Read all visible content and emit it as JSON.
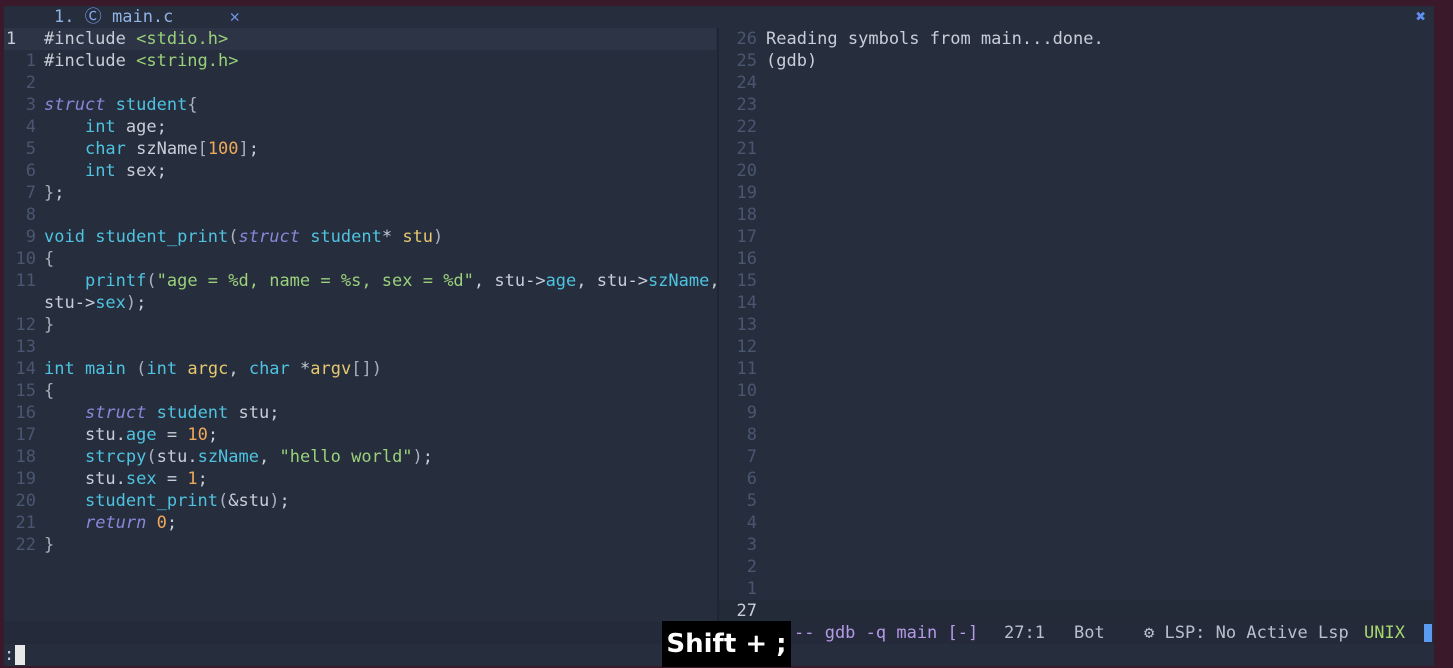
{
  "tab": {
    "index": "1.",
    "icon": "c-file-icon",
    "name": "main.c",
    "close": "✕",
    "close_all": "✖"
  },
  "editor": {
    "lines": [
      {
        "n": "1",
        "cur": true,
        "tokens": [
          [
            "pp",
            "#include "
          ],
          [
            "str",
            "<stdio.h>"
          ]
        ]
      },
      {
        "n": "1",
        "tokens": [
          [
            "pp",
            "#include "
          ],
          [
            "str",
            "<string.h>"
          ]
        ]
      },
      {
        "n": "2",
        "tokens": []
      },
      {
        "n": "3",
        "tokens": [
          [
            "sk",
            "struct"
          ],
          [
            "pp",
            " "
          ],
          [
            "ty",
            "student"
          ],
          [
            "br",
            "{"
          ]
        ]
      },
      {
        "n": "4",
        "tokens": [
          [
            "pp",
            "    "
          ],
          [
            "kw",
            "int"
          ],
          [
            "pp",
            " age;"
          ]
        ]
      },
      {
        "n": "5",
        "tokens": [
          [
            "pp",
            "    "
          ],
          [
            "kw",
            "char"
          ],
          [
            "pp",
            " szName"
          ],
          [
            "br",
            "["
          ],
          [
            "num",
            "100"
          ],
          [
            "br",
            "]"
          ],
          [
            "pp",
            ";"
          ]
        ]
      },
      {
        "n": "6",
        "tokens": [
          [
            "pp",
            "    "
          ],
          [
            "kw",
            "int"
          ],
          [
            "pp",
            " sex;"
          ]
        ]
      },
      {
        "n": "7",
        "tokens": [
          [
            "br",
            "}"
          ],
          [
            "pp",
            ";"
          ]
        ]
      },
      {
        "n": "8",
        "tokens": []
      },
      {
        "n": "9",
        "tokens": [
          [
            "kw",
            "void"
          ],
          [
            "pp",
            " "
          ],
          [
            "fn",
            "student_print"
          ],
          [
            "br",
            "("
          ],
          [
            "sk",
            "struct"
          ],
          [
            "pp",
            " "
          ],
          [
            "ty",
            "student"
          ],
          [
            "pp",
            "* "
          ],
          [
            "pa",
            "stu"
          ],
          [
            "br",
            ")"
          ]
        ]
      },
      {
        "n": "10",
        "tokens": [
          [
            "br",
            "{"
          ]
        ]
      },
      {
        "n": "11",
        "tokens": [
          [
            "pp",
            "    "
          ],
          [
            "fn",
            "printf"
          ],
          [
            "br",
            "("
          ],
          [
            "str",
            "\"age = %d, name = %s, sex = %d\""
          ],
          [
            "pp",
            ", stu->"
          ],
          [
            "fn",
            "age"
          ],
          [
            "pp",
            ", stu->"
          ],
          [
            "fn",
            "szName"
          ],
          [
            "pp",
            ","
          ]
        ]
      },
      {
        "n": "",
        "tokens": [
          [
            "pp",
            "stu->"
          ],
          [
            "fn",
            "sex"
          ],
          [
            "br",
            ")"
          ],
          [
            "pp",
            ";"
          ]
        ]
      },
      {
        "n": "12",
        "tokens": [
          [
            "br",
            "}"
          ]
        ]
      },
      {
        "n": "13",
        "tokens": []
      },
      {
        "n": "14",
        "tokens": [
          [
            "kw",
            "int"
          ],
          [
            "pp",
            " "
          ],
          [
            "fn",
            "main"
          ],
          [
            "pp",
            " "
          ],
          [
            "br",
            "("
          ],
          [
            "kw",
            "int"
          ],
          [
            "pp",
            " "
          ],
          [
            "pa",
            "argc"
          ],
          [
            "pp",
            ", "
          ],
          [
            "kw",
            "char"
          ],
          [
            "pp",
            " *"
          ],
          [
            "pa",
            "argv"
          ],
          [
            "br",
            "[])"
          ]
        ]
      },
      {
        "n": "15",
        "tokens": [
          [
            "br",
            "{"
          ]
        ]
      },
      {
        "n": "16",
        "tokens": [
          [
            "pp",
            "    "
          ],
          [
            "sk",
            "struct"
          ],
          [
            "pp",
            " "
          ],
          [
            "ty",
            "student"
          ],
          [
            "pp",
            " stu;"
          ]
        ]
      },
      {
        "n": "17",
        "tokens": [
          [
            "pp",
            "    stu."
          ],
          [
            "fn",
            "age"
          ],
          [
            "pp",
            " = "
          ],
          [
            "num",
            "10"
          ],
          [
            "pp",
            ";"
          ]
        ]
      },
      {
        "n": "18",
        "tokens": [
          [
            "pp",
            "    "
          ],
          [
            "fn",
            "strcpy"
          ],
          [
            "br",
            "("
          ],
          [
            "pp",
            "stu."
          ],
          [
            "fn",
            "szName"
          ],
          [
            "pp",
            ", "
          ],
          [
            "str",
            "\"hello world\""
          ],
          [
            "br",
            ")"
          ],
          [
            "pp",
            ";"
          ]
        ]
      },
      {
        "n": "19",
        "tokens": [
          [
            "pp",
            "    stu."
          ],
          [
            "fn",
            "sex"
          ],
          [
            "pp",
            " = "
          ],
          [
            "num",
            "1"
          ],
          [
            "pp",
            ";"
          ]
        ]
      },
      {
        "n": "20",
        "tokens": [
          [
            "pp",
            "    "
          ],
          [
            "fn",
            "student_print"
          ],
          [
            "br",
            "("
          ],
          [
            "pp",
            "&stu"
          ],
          [
            "br",
            ")"
          ],
          [
            "pp",
            ";"
          ]
        ]
      },
      {
        "n": "21",
        "tokens": [
          [
            "pp",
            "    "
          ],
          [
            "sk",
            "return"
          ],
          [
            "pp",
            " "
          ],
          [
            "num",
            "0"
          ],
          [
            "pp",
            ";"
          ]
        ]
      },
      {
        "n": "22",
        "tokens": [
          [
            "br",
            "}"
          ]
        ]
      }
    ]
  },
  "terminal": {
    "lines": [
      {
        "n": "26",
        "text": "Reading symbols from main...done."
      },
      {
        "n": "25",
        "text": "(gdb)"
      },
      {
        "n": "24",
        "text": ""
      },
      {
        "n": "23",
        "text": ""
      },
      {
        "n": "22",
        "text": ""
      },
      {
        "n": "21",
        "text": ""
      },
      {
        "n": "20",
        "text": ""
      },
      {
        "n": "19",
        "text": ""
      },
      {
        "n": "18",
        "text": ""
      },
      {
        "n": "17",
        "text": ""
      },
      {
        "n": "16",
        "text": ""
      },
      {
        "n": "15",
        "text": ""
      },
      {
        "n": "14",
        "text": ""
      },
      {
        "n": "13",
        "text": ""
      },
      {
        "n": "12",
        "text": ""
      },
      {
        "n": "11",
        "text": ""
      },
      {
        "n": "10",
        "text": ""
      },
      {
        "n": "9",
        "text": ""
      },
      {
        "n": "8",
        "text": ""
      },
      {
        "n": "7",
        "text": ""
      },
      {
        "n": "6",
        "text": ""
      },
      {
        "n": "5",
        "text": ""
      },
      {
        "n": "4",
        "text": ""
      },
      {
        "n": "3",
        "text": ""
      },
      {
        "n": "2",
        "text": ""
      },
      {
        "n": "1",
        "text": ""
      },
      {
        "n": "27",
        "text": "",
        "cur": true
      }
    ]
  },
  "status": {
    "command": "-- gdb -q main [-]",
    "position": "27:1",
    "scroll": "Bot",
    "lsp": "⚙ LSP: No Active Lsp",
    "fileformat": "UNIX"
  },
  "cmdline": {
    "text": ":"
  },
  "keyhint": {
    "text": "Shift + ;"
  }
}
